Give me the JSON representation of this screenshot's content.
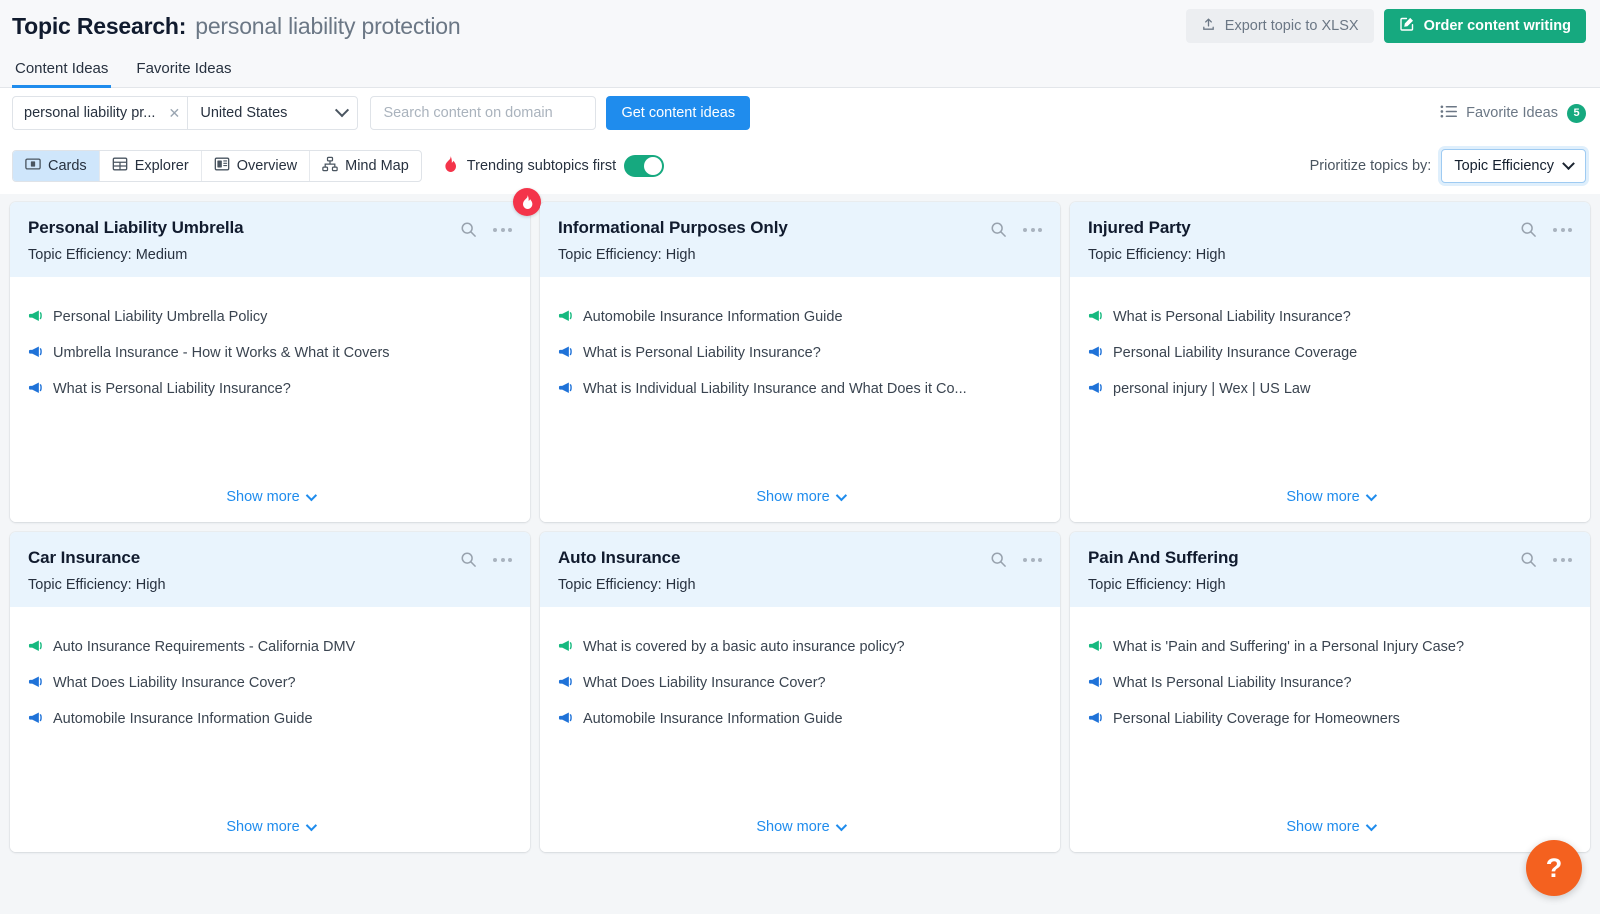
{
  "header": {
    "title": "Topic Research:",
    "subject": "personal liability protection",
    "export_label": "Export topic to XLSX",
    "order_label": "Order content writing"
  },
  "tabs": [
    {
      "label": "Content Ideas",
      "active": true
    },
    {
      "label": "Favorite Ideas",
      "active": false
    }
  ],
  "filters": {
    "keyword": "personal liability pr...",
    "clear": "✕",
    "country": "United States",
    "domain_placeholder": "Search content on domain",
    "domain_value": "",
    "get_ideas_label": "Get content ideas",
    "favorite_ideas_label": "Favorite Ideas",
    "favorite_ideas_count": "5"
  },
  "viewbar": {
    "views": [
      {
        "label": "Cards",
        "icon": "cards-icon",
        "active": true
      },
      {
        "label": "Explorer",
        "icon": "table-icon",
        "active": false
      },
      {
        "label": "Overview",
        "icon": "overview-icon",
        "active": false
      },
      {
        "label": "Mind Map",
        "icon": "mindmap-icon",
        "active": false
      }
    ],
    "trending_label": "Trending subtopics first",
    "trending_on": true,
    "prioritize_label": "Prioritize topics by:",
    "prioritize_value": "Topic Efficiency"
  },
  "show_more_label": "Show more",
  "help_label": "?",
  "colors": {
    "accent_blue": "#1f8ced",
    "accent_green": "#16a97f",
    "flame_red": "#f4344a",
    "help_orange": "#f4611f",
    "card_header": "#e9f4fd"
  },
  "cards": [
    {
      "title": "Personal Liability Umbrella",
      "efficiency": "Topic Efficiency: Medium",
      "trending": true,
      "ideas": [
        {
          "text": "Personal Liability Umbrella Policy",
          "color": "green"
        },
        {
          "text": "Umbrella Insurance - How it Works & What it Covers",
          "color": "blue"
        },
        {
          "text": "What is Personal Liability Insurance?",
          "color": "blue"
        }
      ]
    },
    {
      "title": "Informational Purposes Only",
      "efficiency": "Topic Efficiency: High",
      "trending": false,
      "ideas": [
        {
          "text": "Automobile Insurance Information Guide",
          "color": "green"
        },
        {
          "text": "What is Personal Liability Insurance?",
          "color": "blue"
        },
        {
          "text": "What is Individual Liability Insurance and What Does it Co...",
          "color": "blue"
        }
      ]
    },
    {
      "title": "Injured Party",
      "efficiency": "Topic Efficiency: High",
      "trending": false,
      "ideas": [
        {
          "text": "What is Personal Liability Insurance?",
          "color": "green"
        },
        {
          "text": "Personal Liability Insurance Coverage",
          "color": "blue"
        },
        {
          "text": "personal injury | Wex | US Law",
          "color": "blue"
        }
      ]
    },
    {
      "title": "Car Insurance",
      "efficiency": "Topic Efficiency: High",
      "trending": false,
      "ideas": [
        {
          "text": "Auto Insurance Requirements - California DMV",
          "color": "green"
        },
        {
          "text": "What Does Liability Insurance Cover?",
          "color": "blue"
        },
        {
          "text": "Automobile Insurance Information Guide",
          "color": "blue"
        }
      ]
    },
    {
      "title": "Auto Insurance",
      "efficiency": "Topic Efficiency: High",
      "trending": false,
      "ideas": [
        {
          "text": "What is covered by a basic auto insurance policy?",
          "color": "green"
        },
        {
          "text": "What Does Liability Insurance Cover?",
          "color": "blue"
        },
        {
          "text": "Automobile Insurance Information Guide",
          "color": "blue"
        }
      ]
    },
    {
      "title": "Pain And Suffering",
      "efficiency": "Topic Efficiency: High",
      "trending": false,
      "ideas": [
        {
          "text": "What is 'Pain and Suffering' in a Personal Injury Case?",
          "color": "green"
        },
        {
          "text": "What Is Personal Liability Insurance?",
          "color": "blue"
        },
        {
          "text": "Personal Liability Coverage for Homeowners",
          "color": "blue"
        }
      ]
    }
  ]
}
